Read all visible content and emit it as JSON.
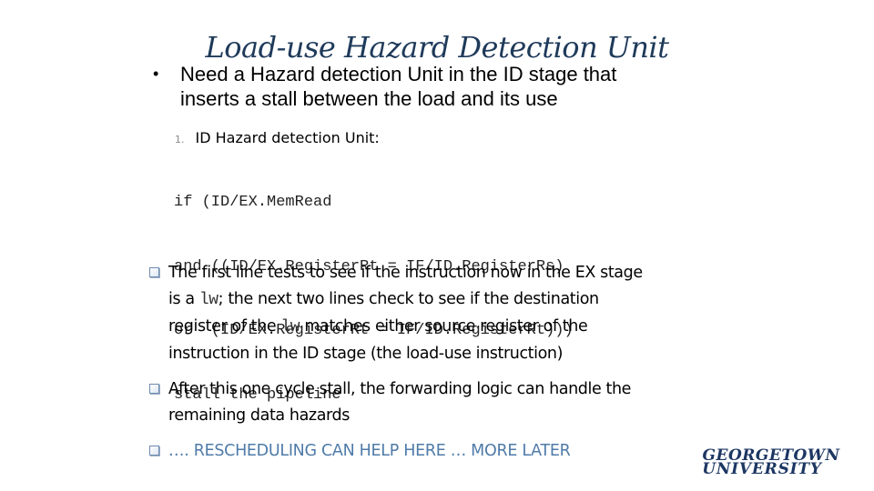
{
  "slide": {
    "title": "Load-use Hazard Detection Unit",
    "main_bullet": {
      "marker": "•",
      "text_line1": "Need a Hazard detection Unit in the ID stage that",
      "text_line2": "inserts a stall between the load and its use"
    },
    "numbered_item": {
      "number": "1.",
      "label": "ID Hazard detection Unit:"
    },
    "code_lines": [
      "if (ID/EX.MemRead",
      "and ((ID/EX.RegisterRt = IF/ID.RegisterRs)",
      "or  (ID/EX.RegisterRt = IF/ID.RegisterRt)))",
      "stall the pipeline"
    ],
    "bullets": [
      {
        "line1": "The first line tests to see if the instruction now in the EX stage",
        "line2_pre": "is a ",
        "line2_code": "lw",
        "line2_post": "; the next two lines check to see if the destination",
        "line3_pre": "register of the ",
        "line3_code": "lw",
        "line3_post": " matches either source register of the",
        "line4": "instruction in the ID stage (the load-use instruction)"
      },
      {
        "line1": "After this one cycle stall, the forwarding logic can handle the",
        "line2": "remaining data hazards"
      },
      {
        "line1": "…. RESCHEDULING CAN HELP HERE … MORE LATER"
      }
    ],
    "logo": {
      "line1": "GEORGETOWN",
      "line2": "UNIVERSITY"
    },
    "colors": {
      "title": "#1f3a5a",
      "accent_text": "#4f7ba8",
      "logo": "#1d3763"
    }
  }
}
